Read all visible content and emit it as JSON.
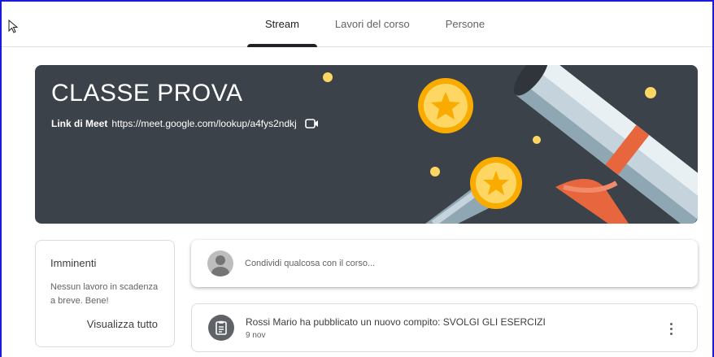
{
  "tabs": [
    {
      "label": "Stream",
      "active": true
    },
    {
      "label": "Lavori del corso",
      "active": false
    },
    {
      "label": "Persone",
      "active": false
    }
  ],
  "banner": {
    "title": "CLASSE PROVA",
    "meet_label": "Link di Meet",
    "meet_link": "https://meet.google.com/lookup/a4fys2ndkj",
    "meet_icon": "video-camera-icon",
    "background_color": "#3b4249"
  },
  "upcoming": {
    "title": "Imminenti",
    "message": "Nessun lavoro in scadenza a breve. Bene!",
    "view_all": "Visualizza tutto"
  },
  "share": {
    "placeholder": "Condividi qualcosa con il corso..."
  },
  "posts": [
    {
      "title": "Rossi Mario ha pubblicato un nuovo compito: SVOLGI GLI ESERCIZI",
      "date": "9 nov",
      "icon": "assignment-icon"
    }
  ]
}
